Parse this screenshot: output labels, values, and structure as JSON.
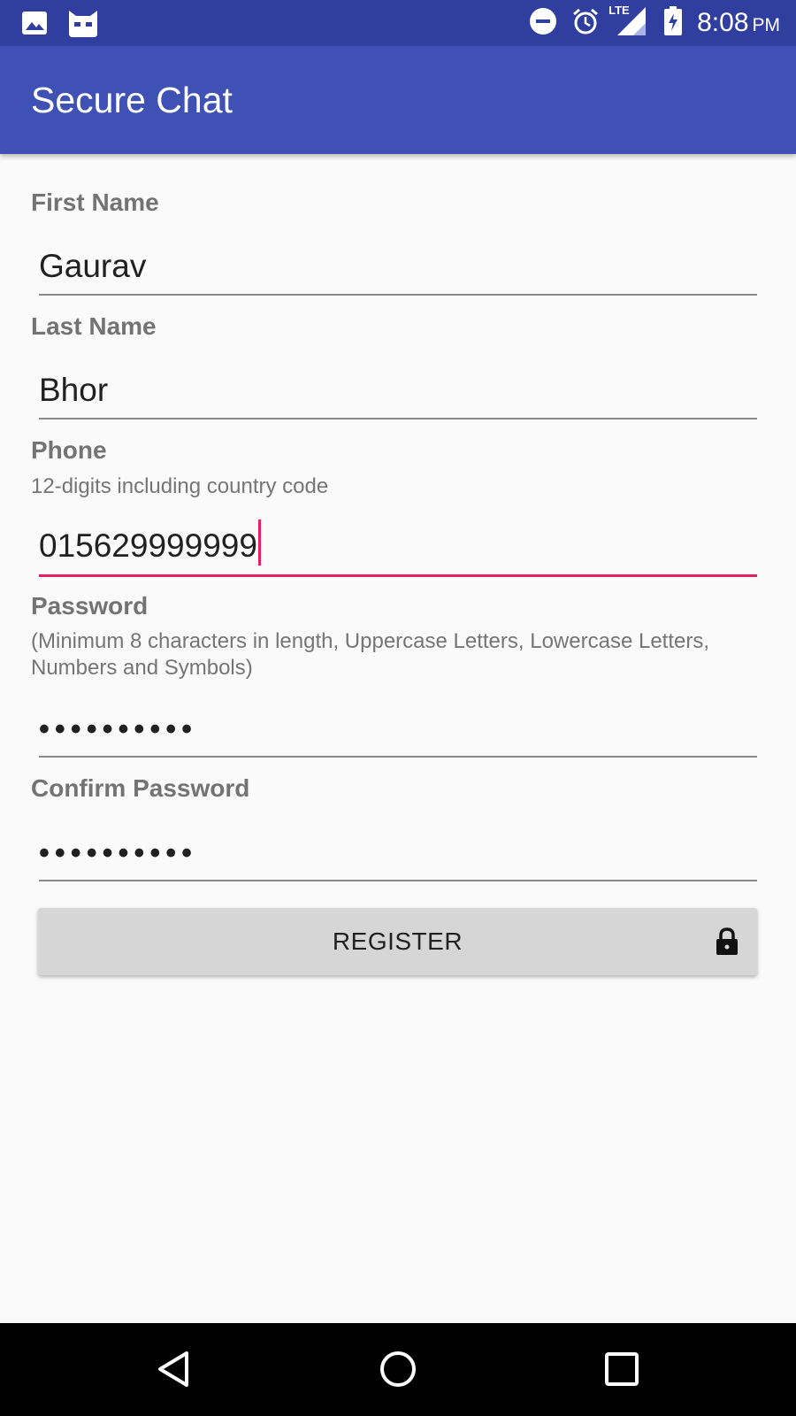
{
  "status_bar": {
    "left_icons": [
      "image-icon",
      "cyanogen-bot-icon"
    ],
    "right_icons": [
      "do-not-disturb-icon",
      "alarm-icon",
      "lte-signal-icon",
      "battery-charging-icon"
    ],
    "lte_label": "LTE",
    "time": "8:08",
    "ampm": "PM"
  },
  "app_bar": {
    "title": "Secure Chat",
    "background": "#3f51b5",
    "status_background": "#303f9f"
  },
  "form": {
    "first_name": {
      "label": "First Name",
      "value": "Gaurav"
    },
    "last_name": {
      "label": "Last Name",
      "value": "Bhor"
    },
    "phone": {
      "label": "Phone",
      "hint": "12-digits including country code",
      "value": "015629999999",
      "focused": true
    },
    "password": {
      "label": "Password",
      "hint": "(Minimum 8 characters in length, Uppercase Letters, Lowercase Letters, Numbers and Symbols)",
      "value": "••••••••••"
    },
    "confirm_password": {
      "label": "Confirm Password",
      "value": "••••••••••"
    }
  },
  "register_button": {
    "label": "REGISTER",
    "icon": "lock-icon"
  },
  "nav_bar": {
    "items": [
      "back-icon",
      "home-icon",
      "recents-icon"
    ]
  },
  "colors": {
    "accent": "#e91e63",
    "label": "#737373",
    "button": "#d6d6d6"
  }
}
